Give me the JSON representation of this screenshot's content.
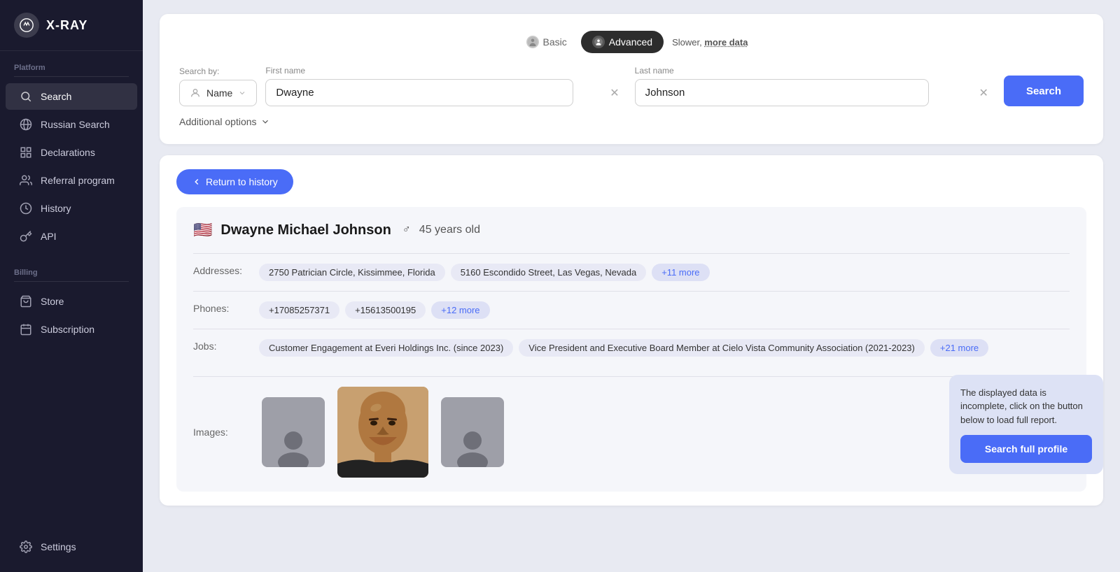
{
  "app": {
    "logo_text": "X-RAY",
    "logo_icon": "✦"
  },
  "sidebar": {
    "platform_label": "Platform",
    "billing_label": "Billing",
    "items_platform": [
      {
        "id": "search",
        "label": "Search",
        "icon": "search",
        "active": true
      },
      {
        "id": "russian-search",
        "label": "Russian Search",
        "icon": "globe"
      },
      {
        "id": "declarations",
        "label": "Declarations",
        "icon": "grid"
      },
      {
        "id": "referral",
        "label": "Referral program",
        "icon": "users"
      },
      {
        "id": "history",
        "label": "History",
        "icon": "clock"
      },
      {
        "id": "api",
        "label": "API",
        "icon": "key"
      }
    ],
    "items_billing": [
      {
        "id": "store",
        "label": "Store",
        "icon": "bag"
      },
      {
        "id": "subscription",
        "label": "Subscription",
        "icon": "calendar"
      }
    ],
    "settings_label": "Settings",
    "settings_icon": "gear"
  },
  "search_panel": {
    "mode_basic": "Basic",
    "mode_advanced": "Advanced",
    "mode_slow_text": "Slower, more data",
    "search_by_label": "Search by:",
    "search_by_value": "Name",
    "first_name_label": "First name",
    "first_name_value": "Dwayne",
    "last_name_label": "Last name",
    "last_name_value": "Johnson",
    "search_button": "Search",
    "additional_options": "Additional options"
  },
  "results": {
    "return_button": "Return to history",
    "profile": {
      "flag": "🇺🇸",
      "name": "Dwayne Michael Johnson",
      "gender": "♂",
      "age": "45 years old",
      "addresses_label": "Addresses:",
      "addresses": [
        "2750 Patrician Circle, Kissimmee, Florida",
        "5160 Escondido Street, Las Vegas, Nevada",
        "+11 more"
      ],
      "phones_label": "Phones:",
      "phones": [
        "+17085257371",
        "+15613500195",
        "+12 more"
      ],
      "jobs_label": "Jobs:",
      "jobs": [
        "Customer Engagement at Everi Holdings Inc. (since 2023)",
        "Vice President and Executive Board Member at Cielo Vista Community Association (2021-2023)",
        "+21 more"
      ],
      "images_label": "Images:"
    }
  },
  "tooltip": {
    "text": "The displayed data is incomplete, click on the button below to load full report.",
    "button": "Search full profile"
  }
}
